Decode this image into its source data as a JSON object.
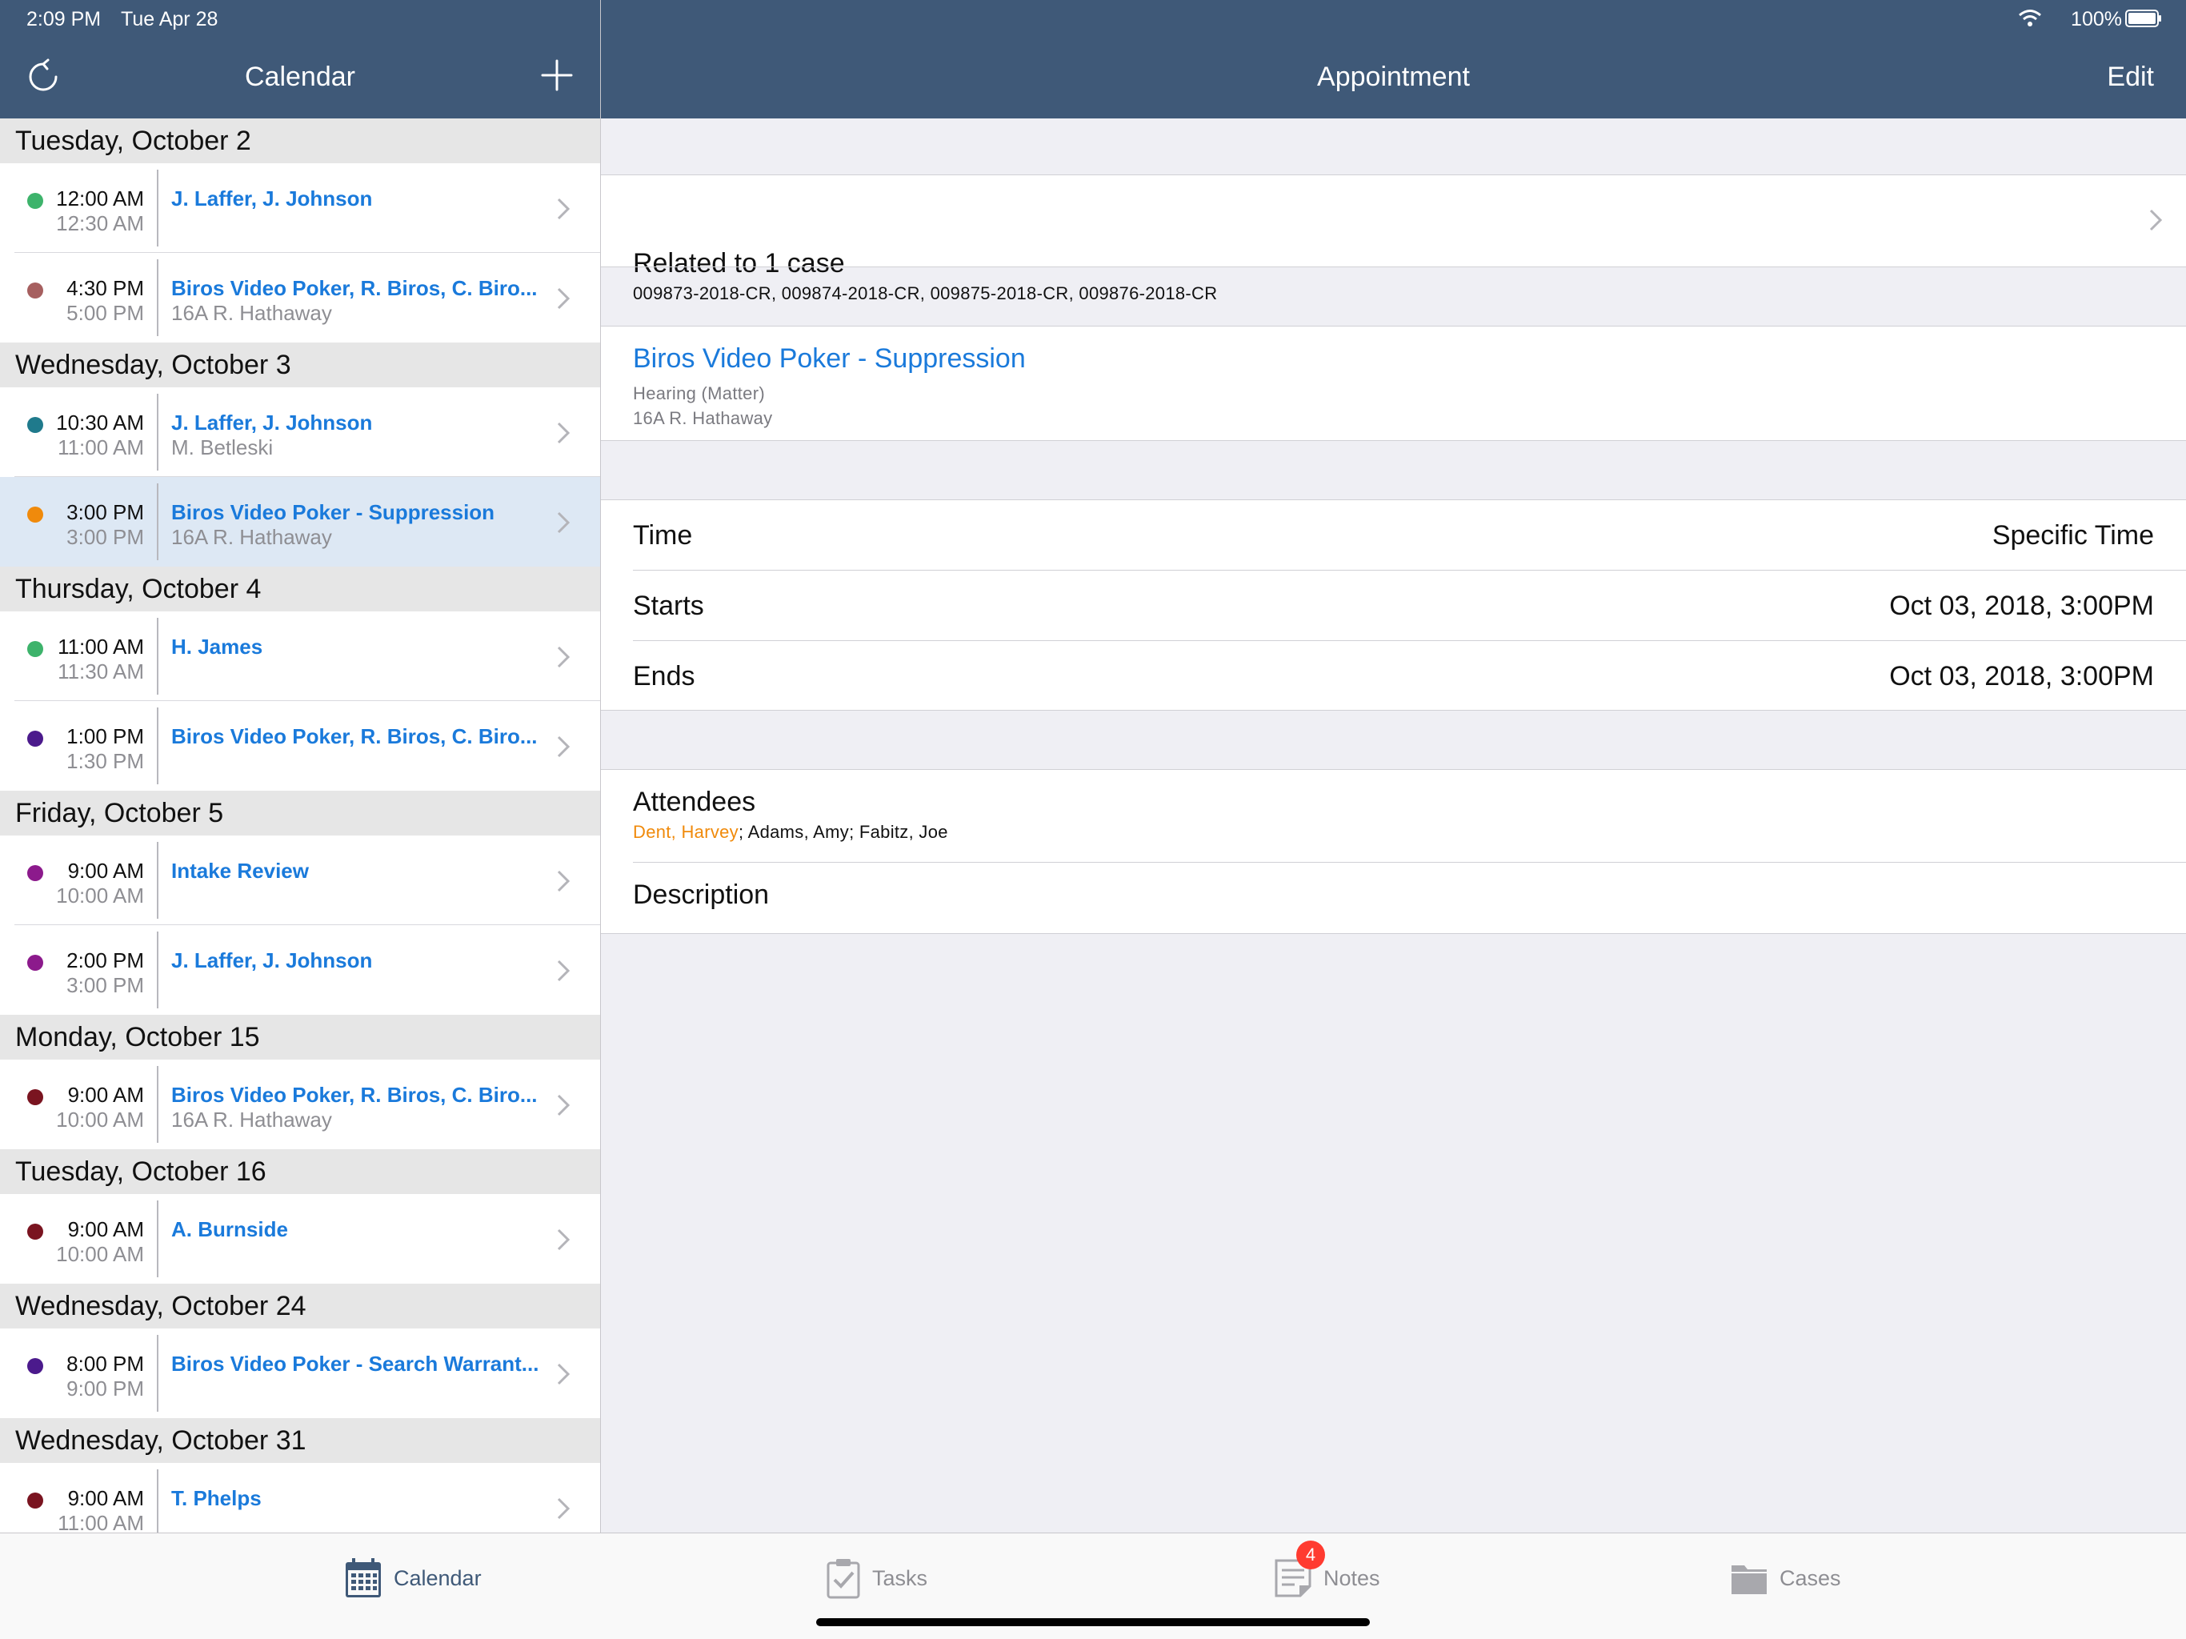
{
  "status_bar": {
    "time": "2:09 PM",
    "date": "Tue Apr 28",
    "battery": "100%"
  },
  "left_nav": {
    "title": "Calendar"
  },
  "calendar": {
    "days": [
      {
        "header": "Tuesday, October 2",
        "events": [
          {
            "start": "12:00 AM",
            "end": "12:30 AM",
            "title": "J. Laffer, J. Johnson",
            "subtitle": "",
            "dot_color": "#3db36b",
            "selected": false
          },
          {
            "start": "4:30 PM",
            "end": "5:00 PM",
            "title": "Biros Video Poker, R. Biros, C. Biro...",
            "subtitle": "16A R. Hathaway",
            "dot_color": "#a65f5f",
            "selected": false
          }
        ]
      },
      {
        "header": "Wednesday, October 3",
        "events": [
          {
            "start": "10:30 AM",
            "end": "11:00 AM",
            "title": "J. Laffer, J. Johnson",
            "subtitle": "M. Betleski",
            "dot_color": "#1f7a8c",
            "selected": false
          },
          {
            "start": "3:00 PM",
            "end": "3:00 PM",
            "title": "Biros Video Poker - Suppression",
            "subtitle": "16A R. Hathaway",
            "dot_color": "#f08a0b",
            "selected": true
          }
        ]
      },
      {
        "header": "Thursday, October 4",
        "events": [
          {
            "start": "11:00 AM",
            "end": "11:30 AM",
            "title": "H. James",
            "subtitle": "",
            "dot_color": "#3db36b",
            "selected": false
          },
          {
            "start": "1:00 PM",
            "end": "1:30 PM",
            "title": "Biros Video Poker, R. Biros, C. Biro...",
            "subtitle": "",
            "dot_color": "#4b1a8c",
            "selected": false
          }
        ]
      },
      {
        "header": "Friday, October 5",
        "events": [
          {
            "start": "9:00 AM",
            "end": "10:00 AM",
            "title": "Intake Review",
            "subtitle": "",
            "dot_color": "#8c1a8c",
            "selected": false
          },
          {
            "start": "2:00 PM",
            "end": "3:00 PM",
            "title": "J. Laffer, J. Johnson",
            "subtitle": "",
            "dot_color": "#8c1a8c",
            "selected": false
          }
        ]
      },
      {
        "header": "Monday, October 15",
        "events": [
          {
            "start": "9:00 AM",
            "end": "10:00 AM",
            "title": "Biros Video Poker, R. Biros, C. Biro...",
            "subtitle": "16A R. Hathaway",
            "dot_color": "#7a1420",
            "selected": false
          }
        ]
      },
      {
        "header": "Tuesday, October 16",
        "events": [
          {
            "start": "9:00 AM",
            "end": "10:00 AM",
            "title": "A. Burnside",
            "subtitle": "",
            "dot_color": "#7a1420",
            "selected": false
          }
        ]
      },
      {
        "header": "Wednesday, October 24",
        "events": [
          {
            "start": "8:00 PM",
            "end": "9:00 PM",
            "title": "Biros Video Poker - Search Warrant...",
            "subtitle": "",
            "dot_color": "#4b1a8c",
            "selected": false
          }
        ]
      },
      {
        "header": "Wednesday, October 31",
        "events": [
          {
            "start": "9:00 AM",
            "end": "11:00 AM",
            "title": "T. Phelps",
            "subtitle": "",
            "dot_color": "#7a1420",
            "selected": false
          }
        ]
      }
    ]
  },
  "detail_nav": {
    "title": "Appointment",
    "edit_label": "Edit"
  },
  "detail": {
    "related": {
      "title": "Related to 1 case",
      "cases": "009873-2018-CR, 009874-2018-CR, 009875-2018-CR, 009876-2018-CR"
    },
    "event": {
      "title": "Biros Video Poker - Suppression",
      "type": "Hearing (Matter)",
      "location": "16A R. Hathaway"
    },
    "time": {
      "time_label": "Time",
      "time_value": "Specific Time",
      "starts_label": "Starts",
      "starts_value": "Oct 03, 2018, 3:00PM",
      "ends_label": "Ends",
      "ends_value": "Oct 03, 2018, 3:00PM"
    },
    "attendees": {
      "label": "Attendees",
      "primary": "Dent, Harvey",
      "others": "; Adams, Amy; Fabitz, Joe"
    },
    "description_label": "Description"
  },
  "tab_bar": {
    "tabs": [
      {
        "label": "Calendar",
        "icon": "calendar-icon",
        "active": true
      },
      {
        "label": "Tasks",
        "icon": "clipboard-check-icon",
        "active": false
      },
      {
        "label": "Notes",
        "icon": "notes-icon",
        "active": false
      },
      {
        "label": "Cases",
        "icon": "folder-icon",
        "active": false
      }
    ],
    "notes_badge": "4"
  },
  "colors": {
    "nav_bar": "#3f5978",
    "link_blue": "#1a7adb",
    "attendee_highlight": "#f08a0b",
    "badge_red": "#ff3b30"
  }
}
